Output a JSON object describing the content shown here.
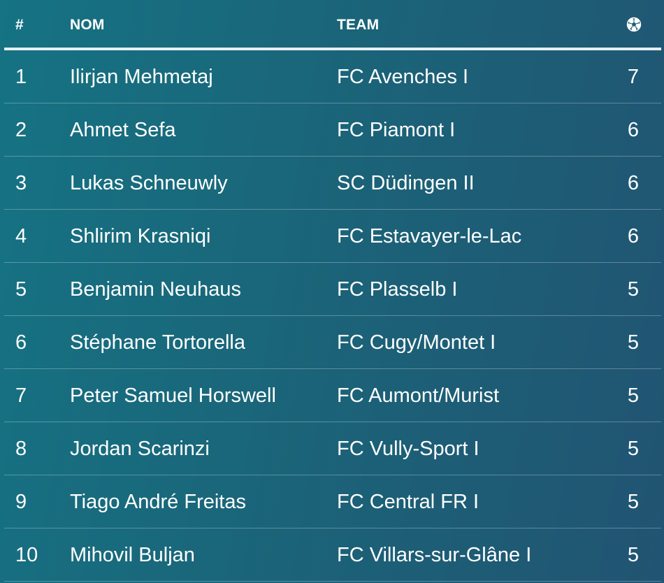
{
  "table": {
    "headers": {
      "rank": "#",
      "name": "NOM",
      "team": "TEAM",
      "goals_icon": "soccer-ball-icon"
    },
    "rows": [
      {
        "rank": "1",
        "name": "Ilirjan Mehmetaj",
        "team": "FC Avenches I",
        "goals": "7"
      },
      {
        "rank": "2",
        "name": "Ahmet Sefa",
        "team": "FC Piamont I",
        "goals": "6"
      },
      {
        "rank": "3",
        "name": "Lukas Schneuwly",
        "team": "SC Düdingen II",
        "goals": "6"
      },
      {
        "rank": "4",
        "name": "Shlirim Krasniqi",
        "team": "FC Estavayer-le-Lac",
        "goals": "6"
      },
      {
        "rank": "5",
        "name": "Benjamin Neuhaus",
        "team": "FC Plasselb I",
        "goals": "5"
      },
      {
        "rank": "6",
        "name": "Stéphane Tortorella",
        "team": "FC Cugy/Montet I",
        "goals": "5"
      },
      {
        "rank": "7",
        "name": "Peter Samuel Horswell",
        "team": "FC Aumont/Murist",
        "goals": "5"
      },
      {
        "rank": "8",
        "name": "Jordan Scarinzi",
        "team": "FC Vully-Sport I",
        "goals": "5"
      },
      {
        "rank": "9",
        "name": "Tiago André Freitas",
        "team": "FC Central FR I",
        "goals": "5"
      },
      {
        "rank": "10",
        "name": "Mihovil Buljan",
        "team": "FC Villars-sur-Glâne I",
        "goals": "5"
      }
    ]
  },
  "colors": {
    "background_start": "#157383",
    "background_end": "#215472",
    "text": "#ffffff",
    "header_rule": "#e6eef2"
  }
}
